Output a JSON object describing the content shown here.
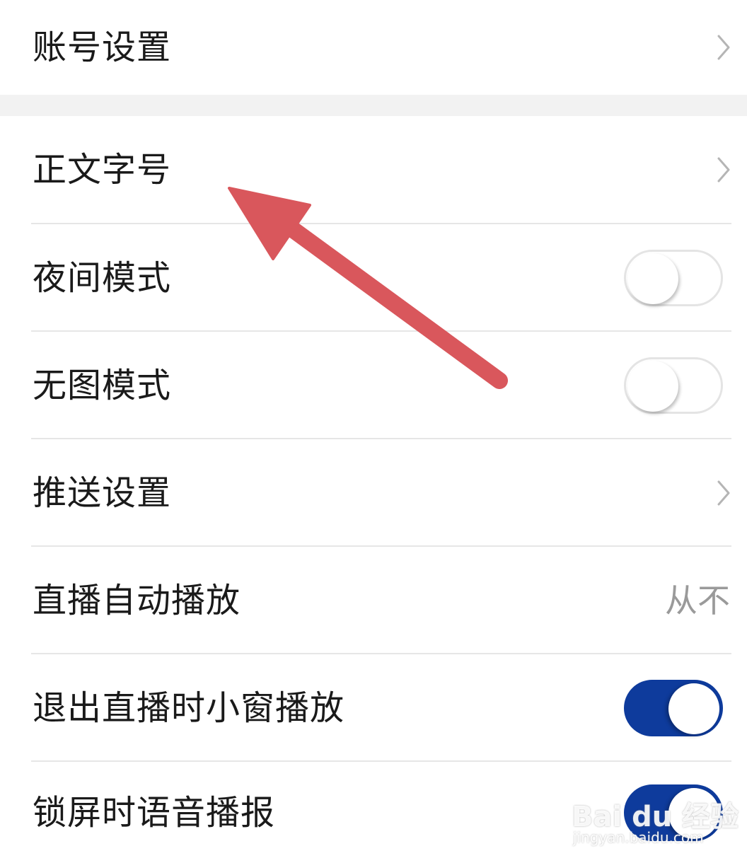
{
  "settings": {
    "account": {
      "label": "账号设置"
    },
    "font_size": {
      "label": "正文字号"
    },
    "night_mode": {
      "label": "夜间模式",
      "enabled": false
    },
    "no_image_mode": {
      "label": "无图模式",
      "enabled": false
    },
    "push_settings": {
      "label": "推送设置"
    },
    "live_autoplay": {
      "label": "直播自动播放",
      "value": "从不"
    },
    "live_exit_pip": {
      "label": "退出直播时小窗播放",
      "enabled": true
    },
    "lockscreen_voice": {
      "label": "锁屏时语音播报",
      "enabled": true
    }
  },
  "watermark": {
    "brand": "Bai du 经验",
    "url": "jingyan.baidu.com"
  },
  "colors": {
    "toggle_on": "#0e3b9c",
    "annotation_arrow": "#d9575c",
    "divider": "#e6e6e6",
    "value_text": "#9a9a9a"
  },
  "icons": {
    "chevron": "chevron-right-icon",
    "annotation": "red-arrow-annotation"
  }
}
